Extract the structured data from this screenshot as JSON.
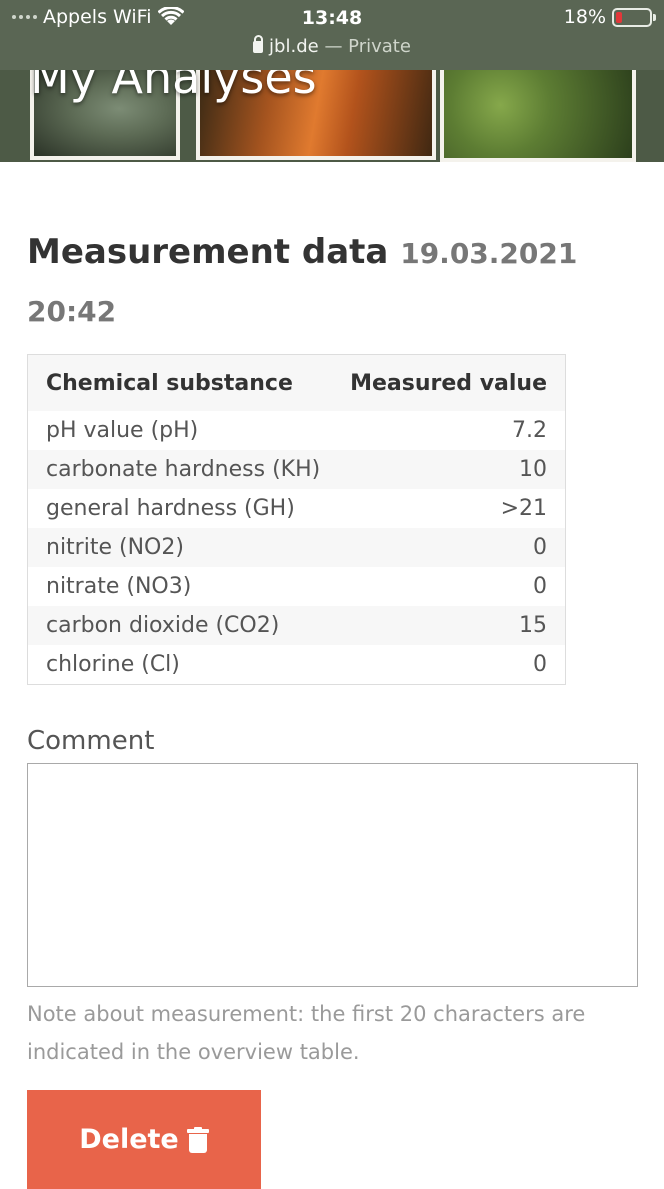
{
  "status_bar": {
    "carrier": "Appels WiFi",
    "time": "13:48",
    "battery_percent": "18%",
    "battery_level": 0.18,
    "url": "jbl.de",
    "separator": "—",
    "mode": "Private"
  },
  "banner": {
    "title": "My Analyses"
  },
  "measurement": {
    "heading": "Measurement data",
    "timestamp": "19.03.2021 20:42"
  },
  "table": {
    "headers": [
      "Chemical substance",
      "Measured value"
    ],
    "rows": [
      {
        "substance": "pH value (pH)",
        "value": "7.2"
      },
      {
        "substance": "carbonate hardness (KH)",
        "value": "10"
      },
      {
        "substance": "general hardness (GH)",
        "value": ">21"
      },
      {
        "substance": "nitrite (NO2)",
        "value": "0"
      },
      {
        "substance": "nitrate (NO3)",
        "value": "0"
      },
      {
        "substance": "carbon dioxide (CO2)",
        "value": "15"
      },
      {
        "substance": "chlorine (Cl)",
        "value": "0"
      }
    ]
  },
  "comment": {
    "label": "Comment",
    "value": "",
    "note": "Note about measurement: the first 20 characters are indicated in the overview table."
  },
  "actions": {
    "delete_label": "Delete",
    "delete_color": "#e8644a"
  }
}
